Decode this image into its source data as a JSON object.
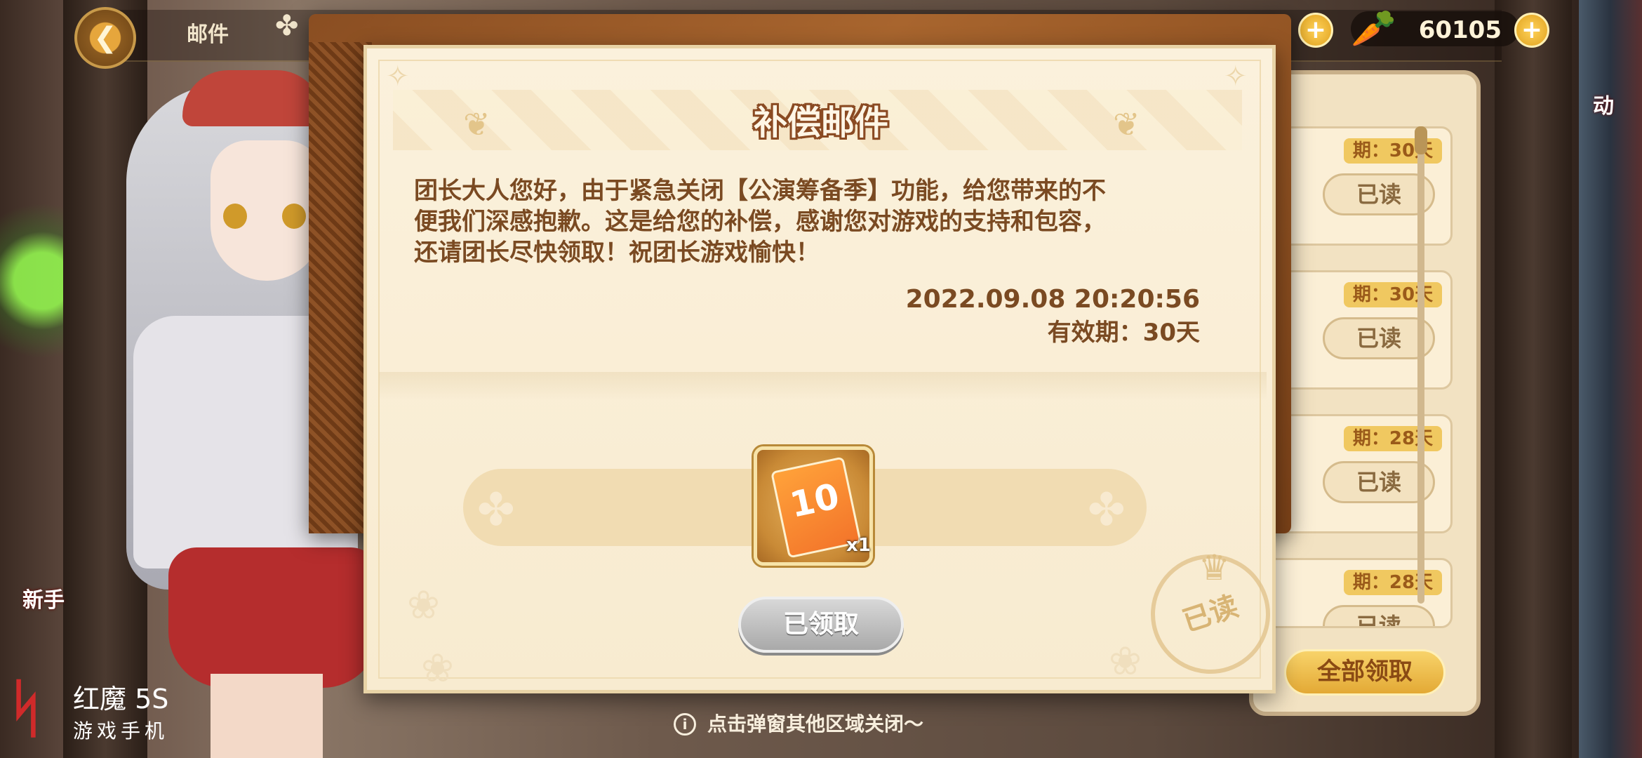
{
  "hud": {
    "title": "邮件",
    "currency_value": "60105"
  },
  "letter": {
    "title": "补偿邮件",
    "body_lines": [
      "团长大人您好，由于紧急关闭【公演筹备季】功能，给您带来的不",
      "便我们深感抱歉。这是给您的补偿，感谢您对游戏的支持和包容，",
      "还请团长尽快领取！祝团长游戏愉快！"
    ],
    "datetime": "2022.09.08 20:20:56",
    "validity": "有效期：30天",
    "reward": {
      "icon": "ticket-10-icon",
      "label": "10",
      "quantity": "x1"
    },
    "claimed_button": "已领取",
    "stamp_text": "已读"
  },
  "mail_list": {
    "items": [
      {
        "badge": "期：30天",
        "status": "已读"
      },
      {
        "badge": "期：30天",
        "status": "已读"
      },
      {
        "badge": "期：28天",
        "status": "已读"
      },
      {
        "badge": "期：28天",
        "status": "已读"
      }
    ],
    "claim_all": "全部领取"
  },
  "side_labels": {
    "left_partial": "新手",
    "right_partial": "动"
  },
  "hint": "点击弹窗其他区域关闭～",
  "watermark": {
    "brand": "红魔 5S",
    "sub": "游戏手机"
  },
  "colors": {
    "title_outline": "#8a4a22",
    "body_text": "#7a4a22",
    "paper": "#fbf1dc",
    "board": "#a8652e"
  }
}
